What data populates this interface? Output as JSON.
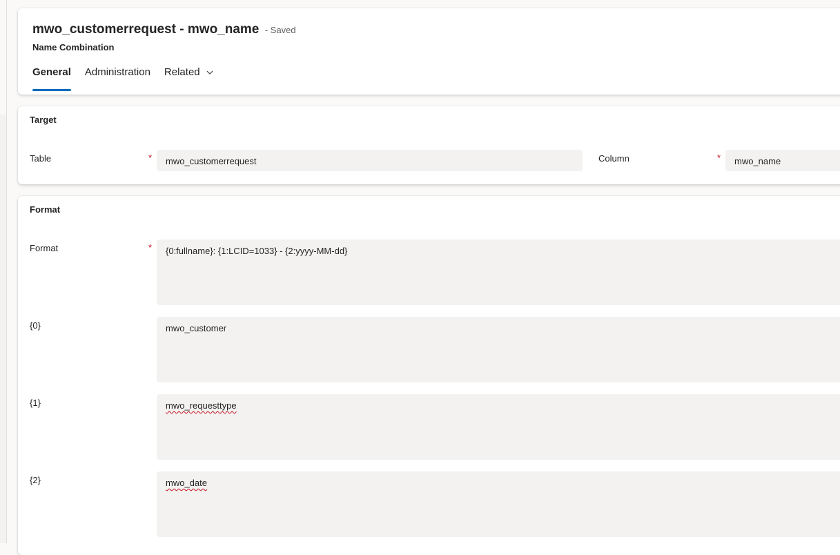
{
  "header": {
    "record_title": "mwo_customerrequest - mwo_name",
    "saved_status": "- Saved",
    "entity_name": "Name Combination",
    "tabs": [
      {
        "label": "General"
      },
      {
        "label": "Administration"
      },
      {
        "label": "Related"
      }
    ]
  },
  "target_section": {
    "title": "Target",
    "table_label": "Table",
    "table_value": "mwo_customerrequest",
    "column_label": "Column",
    "column_value": "mwo_name",
    "required_mark": "*"
  },
  "format_section": {
    "title": "Format",
    "required_mark": "*",
    "fields": [
      {
        "label": "Format",
        "value": "{0:fullname}: {1:LCID=1033} - {2:yyyy-MM-dd}"
      },
      {
        "label": "{0}",
        "value": "mwo_customer"
      },
      {
        "label": "{1}",
        "value": "mwo_requesttype"
      },
      {
        "label": "{2}",
        "value": "mwo_date"
      }
    ]
  },
  "colors": {
    "accent": "#0f6cbd",
    "required": "#c50f1f",
    "field_background": "#f3f2f1"
  },
  "icons": {
    "related_dropdown": "chevron-down-icon"
  }
}
